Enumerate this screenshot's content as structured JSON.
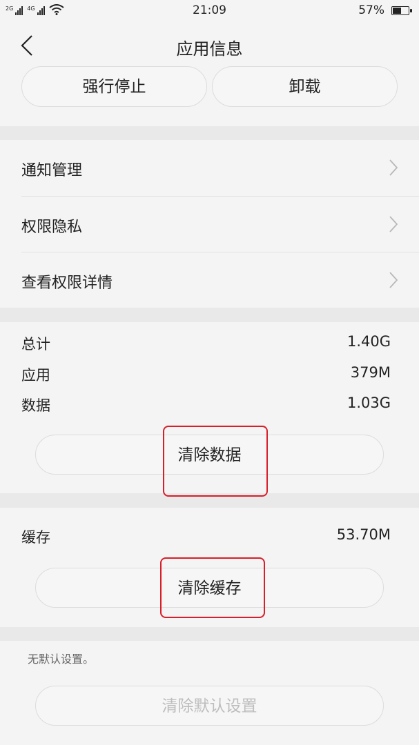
{
  "status_bar": {
    "network_1": "2G",
    "network_2": "4G",
    "time": "21:09",
    "battery_percent": "57%",
    "battery_level": 0.57
  },
  "nav": {
    "title": "应用信息",
    "back_icon": "chevron-left-icon"
  },
  "actions": {
    "force_stop": "强行停止",
    "uninstall": "卸载"
  },
  "menu": [
    {
      "label": "通知管理"
    },
    {
      "label": "权限隐私"
    },
    {
      "label": "查看权限详情"
    }
  ],
  "storage": {
    "total_label": "总计",
    "total_value": "1.40G",
    "app_label": "应用",
    "app_value": "379M",
    "data_label": "数据",
    "data_value": "1.03G",
    "clear_data": "清除数据"
  },
  "cache": {
    "label": "缓存",
    "value": "53.70M",
    "clear_cache": "清除缓存"
  },
  "defaults": {
    "note": "无默认设置。",
    "clear_defaults": "清除默认设置"
  },
  "colors": {
    "highlight": "#d81e2a",
    "background": "#f4f4f4",
    "separator": "#e9e9e9"
  }
}
